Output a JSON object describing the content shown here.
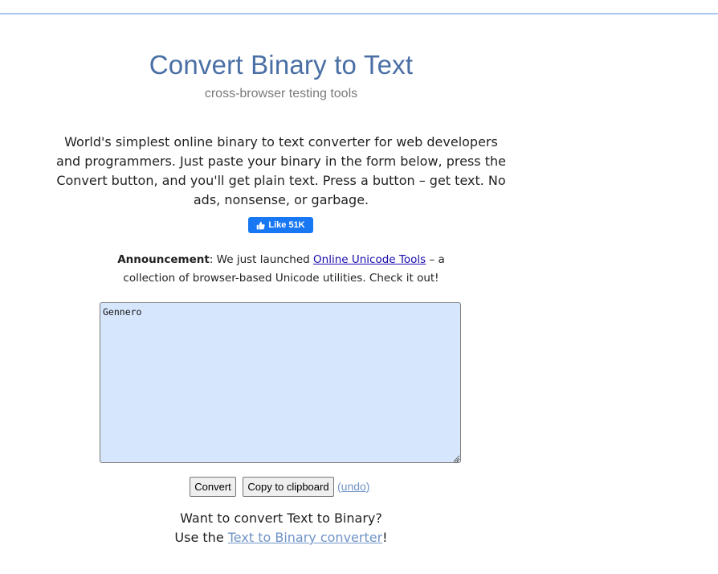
{
  "header": {
    "title": "Convert Binary to Text",
    "subtitle": "cross-browser testing tools"
  },
  "intro": {
    "text": "World's simplest online binary to text converter for web developers and programmers. Just paste your binary in the form below, press the Convert button, and you'll get plain text. Press a button – get text. No ads, nonsense, or garbage."
  },
  "like_button": {
    "label": "Like 51K",
    "icon": "thumbs-up-icon",
    "color": "#1877f2"
  },
  "announcement": {
    "label": "Announcement",
    "text_before": ": We just launched ",
    "link_text": "Online Unicode Tools",
    "text_after": " – a collection of browser-based Unicode utilities. Check it out!"
  },
  "editor": {
    "value": "Gennero",
    "background": "#d6e6fc"
  },
  "actions": {
    "convert_label": "Convert",
    "copy_label": "Copy to clipboard",
    "undo_label": "(undo)"
  },
  "footer": {
    "line1": "Want to convert Text to Binary?",
    "use_the": "Use the ",
    "link_text": "Text to Binary converter",
    "end": "!"
  },
  "colors": {
    "title": "#4a6fa5",
    "link": "#1a0dab",
    "muted_link": "#6f93c7"
  }
}
